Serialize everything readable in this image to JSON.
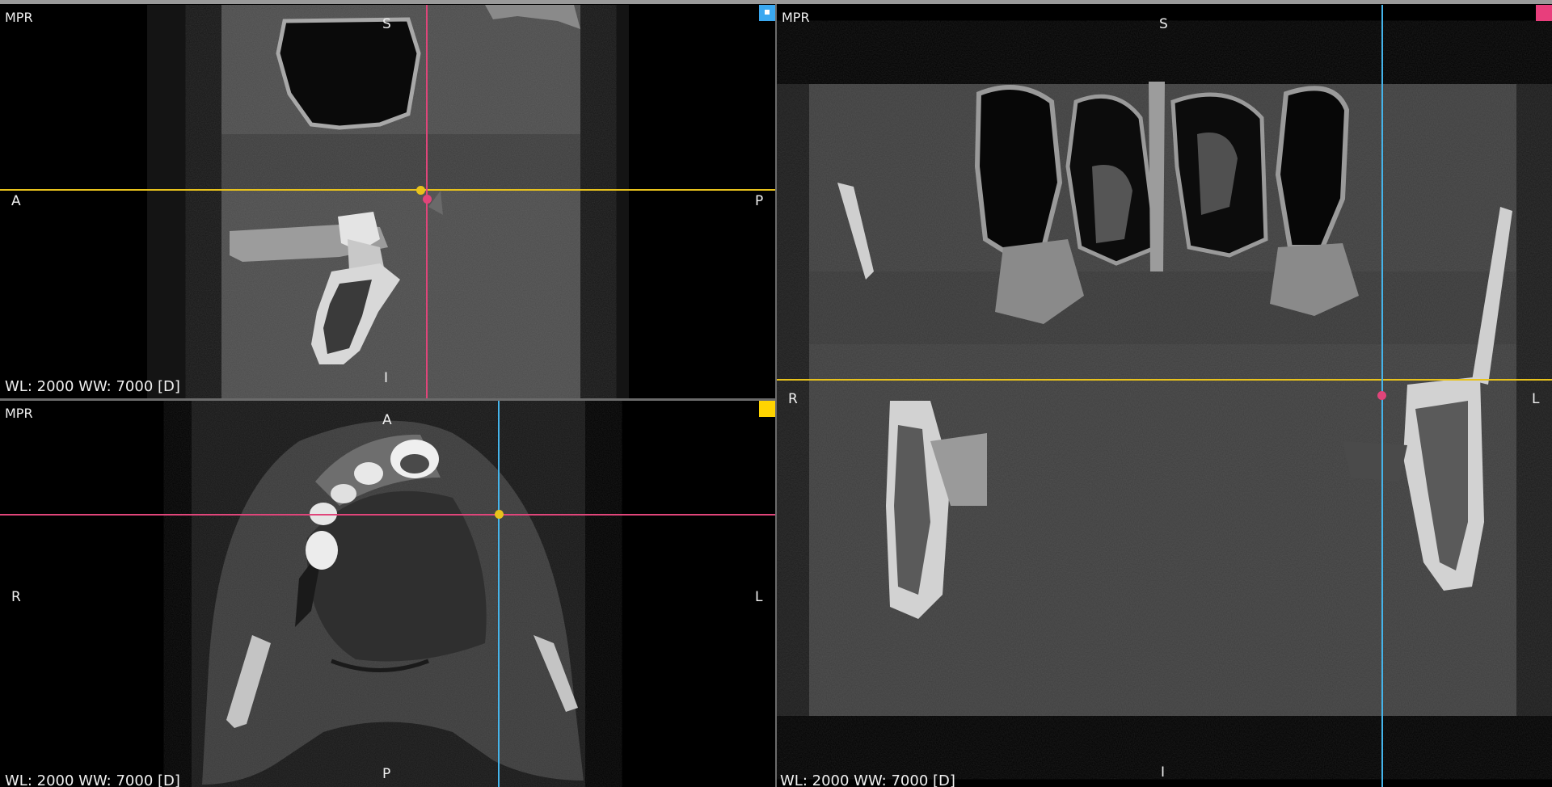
{
  "colors": {
    "sagittal_accent": "#3aa8f0",
    "axial_accent": "#ffd400",
    "coronal_accent": "#e83e7c",
    "crosshair_yellow": "#e8c21c",
    "crosshair_pink": "#e0457a",
    "crosshair_blue": "#45b4ea"
  },
  "viewports": {
    "sagittal": {
      "title": "MPR",
      "orientation": {
        "top": "S",
        "bottom": "I",
        "left": "A",
        "right": "P"
      },
      "window_info": "WL: 2000 WW: 7000 [D]",
      "badge_icon": "square-badge-icon"
    },
    "axial": {
      "title": "MPR",
      "orientation": {
        "top": "A",
        "bottom": "P",
        "left": "R",
        "right": "L"
      },
      "window_info": "WL: 2000 WW: 7000 [D]",
      "badge_icon": "square-badge-icon"
    },
    "coronal": {
      "title": "MPR",
      "orientation": {
        "top": "S",
        "bottom": "I",
        "left": "R",
        "right": "L"
      },
      "window_info": "WL: 2000 WW: 7000 [D]",
      "badge_icon": "square-badge-icon"
    }
  }
}
